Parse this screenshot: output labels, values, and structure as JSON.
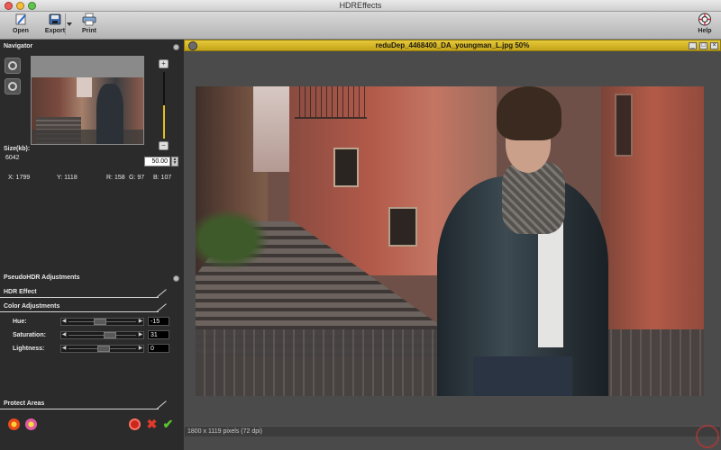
{
  "window": {
    "title": "HDREffects"
  },
  "toolbar": {
    "open": "Open",
    "export": "Export",
    "print": "Print",
    "help": "Help"
  },
  "navigator": {
    "title": "Navigator",
    "size_label": "Size(kb):",
    "size_value": "6042",
    "zoom_value": "50.00",
    "zoom_level": 0.5,
    "x": "X: 1799",
    "y": "Y: 1118",
    "r": "R: 158",
    "g": "G: 97",
    "b": "B: 107"
  },
  "sections": {
    "pseudo_hdr": "PseudoHDR Adjustments",
    "hdr_effect": "HDR Effect",
    "color_adjustments": "Color Adjustments",
    "protect_areas": "Protect Areas"
  },
  "adjustments": [
    {
      "label": "Hue:",
      "value": "-15",
      "knob": 0.45
    },
    {
      "label": "Saturation:",
      "value": "31",
      "knob": 0.62
    },
    {
      "label": "Lightness:",
      "value": "0",
      "knob": 0.5
    }
  ],
  "document": {
    "title": "reduDep_4468400_DA_youngman_L.jpg 50%",
    "status": "1800 x 1119 pixels (72 dpi)"
  },
  "colors": {
    "doc_title_bar": "#d4b529",
    "panel_bg": "#2b2b2b",
    "accent_yellow": "#e0c21c"
  },
  "icons": {
    "open": "open-icon",
    "export": "export-icon",
    "print": "print-icon",
    "help": "help-icon"
  }
}
